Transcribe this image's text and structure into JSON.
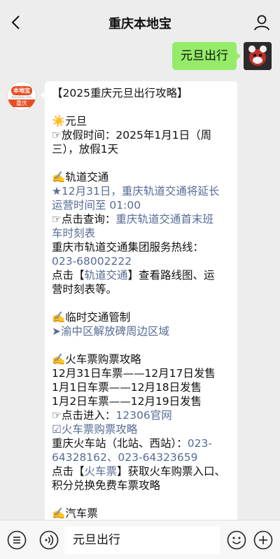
{
  "header": {
    "title": "重庆本地宝"
  },
  "outgoing": {
    "text": "元旦出行"
  },
  "bot_avatar": {
    "top": "本地宝",
    "site": "Bendibao.com",
    "city": "重庆"
  },
  "message": {
    "title": "【2025重庆元旦出行攻略】",
    "holiday_head": "☀️元旦",
    "holiday_1": "☞放假时间：2025年1月1日（周",
    "holiday_2": "三），放假1天",
    "rail_head": "✍️轨道交通",
    "rail_1": "★12月31日，重庆轨道交通将延长",
    "rail_2": "运营时间至 01:00",
    "rail_q_prefix": "☞点击查询：",
    "rail_q_link": "重庆轨道交通首末班",
    "rail_q_link2": "车时刻表",
    "rail_hotline": "重庆市轨道交通集团服务热线：",
    "rail_phone": "023-68002222",
    "rail_click_prefix": "点击【",
    "rail_click_link": "轨道交通",
    "rail_click_suffix": "】查看路线图、运",
    "rail_click_2": "营时刻表等。",
    "traffic_head": "✍️临时交通管制",
    "traffic_link": "➤渝中区解放碑周边区域",
    "train_head": "✍️火车票购票攻略",
    "train_1": "12月31日车票——12月17日发售",
    "train_2": "1月1日车票——12月18日发售",
    "train_3": "1月2日车票——12月19日发售",
    "train_enter_prefix": "☞点击进入：",
    "train_enter_link": "12306官网",
    "train_guide_link": "☑火车票购票攻略",
    "train_station_prefix": "重庆火车站（北站、西站）：",
    "train_station_phone1": "023-",
    "train_station_phone2": "64328162、023-64323659",
    "train_click_prefix": "点击【",
    "train_click_link": "火车票",
    "train_click_suffix": "】获取火车购票入口、",
    "train_click_2": "积分兑换免费车票攻略",
    "bus_head": "✍️汽车票"
  },
  "input": {
    "value": "元旦出行"
  },
  "icons": {
    "back": "chevron-left-icon",
    "profile": "person-icon",
    "menu": "list-menu-icon",
    "voice": "voice-icon",
    "emoji": "emoji-icon",
    "plus": "plus-icon"
  },
  "colors": {
    "bubble_out": "#95ec69",
    "link": "#576b95",
    "brand": "#e94d1f"
  }
}
